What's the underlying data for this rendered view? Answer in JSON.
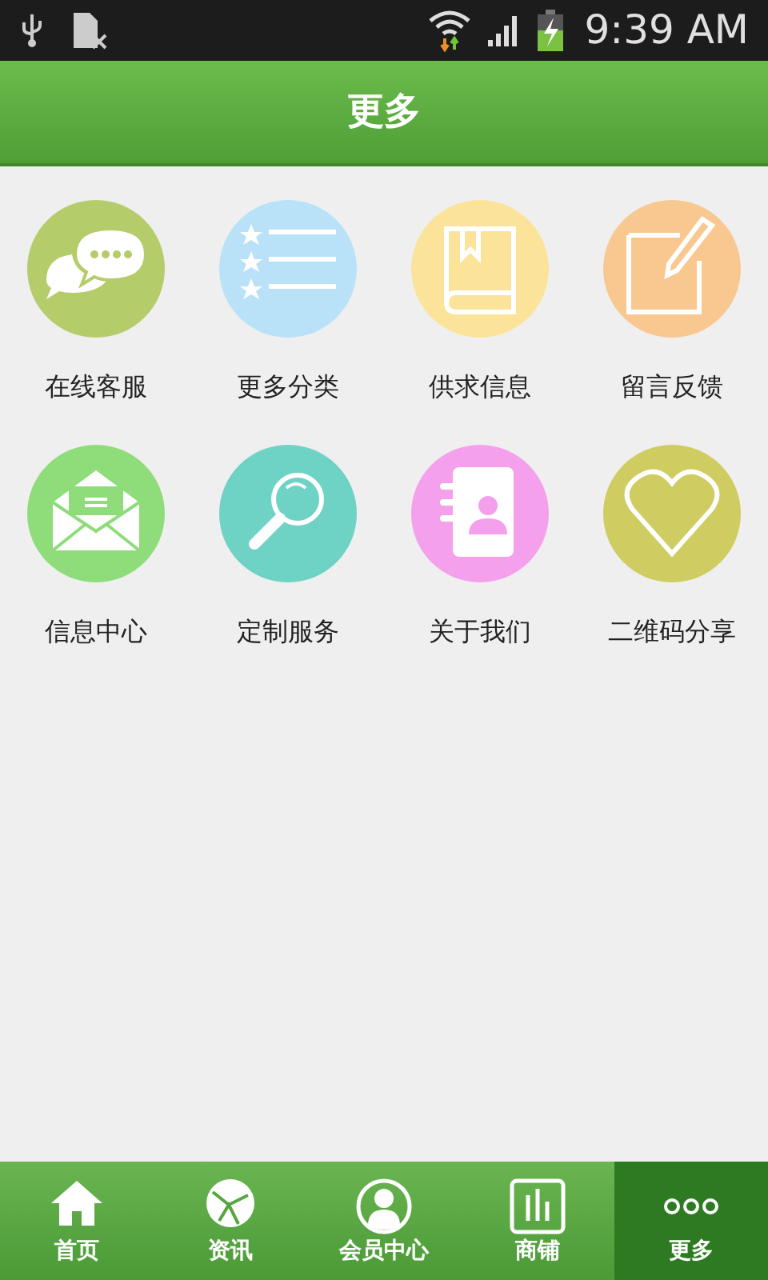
{
  "status_bar": {
    "time": "9:39 AM"
  },
  "header": {
    "title": "更多"
  },
  "grid": [
    {
      "label": "在线客服",
      "color": "#b5cc6a"
    },
    {
      "label": "更多分类",
      "color": "#b9e2f8"
    },
    {
      "label": "供求信息",
      "color": "#fbe49a"
    },
    {
      "label": "留言反馈",
      "color": "#f8c890"
    },
    {
      "label": "信息中心",
      "color": "#8edc7a"
    },
    {
      "label": "定制服务",
      "color": "#6ed3c4"
    },
    {
      "label": "关于我们",
      "color": "#f4a0ec"
    },
    {
      "label": "二维码分享",
      "color": "#cfcc62"
    }
  ],
  "bottom_nav": [
    {
      "label": "首页",
      "selected": false
    },
    {
      "label": "资讯",
      "selected": false
    },
    {
      "label": "会员中心",
      "selected": false
    },
    {
      "label": "商铺",
      "selected": false
    },
    {
      "label": "更多",
      "selected": true
    }
  ]
}
